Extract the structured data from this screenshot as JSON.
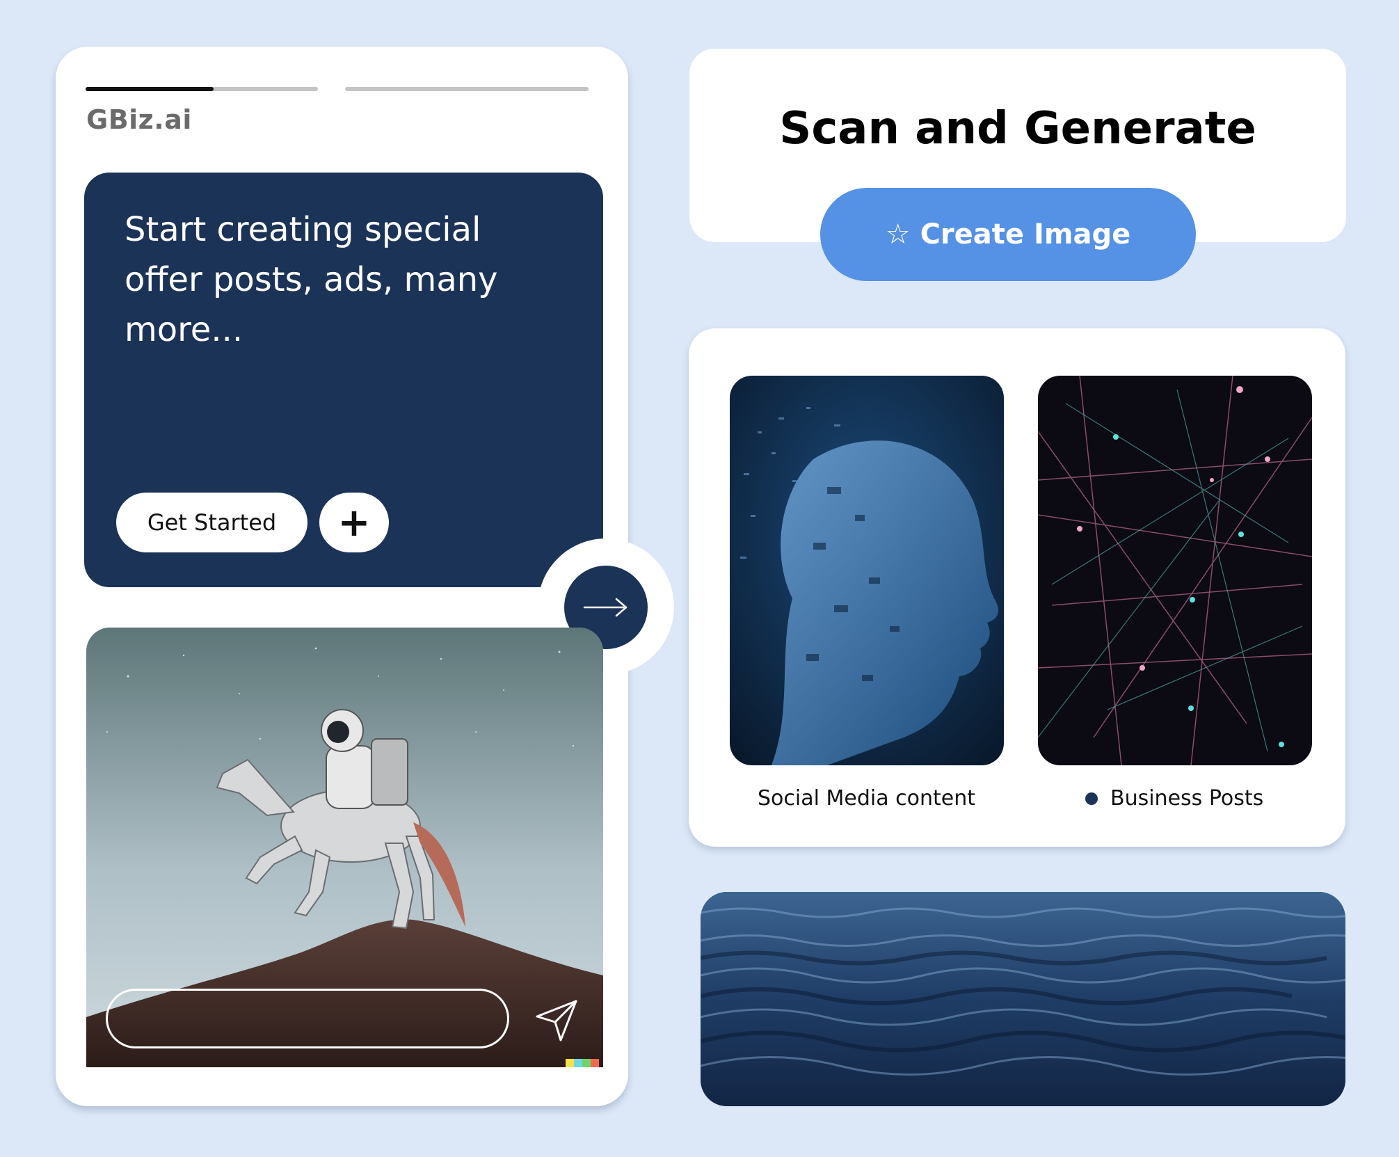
{
  "left_card": {
    "brand": "GBiz.ai",
    "progress": [
      {
        "fraction": 0.55
      },
      {
        "fraction": 0.0
      }
    ],
    "promo": {
      "text": "Start creating special offer posts, ads, many more...",
      "get_started_label": "Get Started",
      "plus_label": "+"
    },
    "prompt_input": {
      "placeholder": "",
      "value": ""
    },
    "icons": {
      "arrow": "arrow-right-icon",
      "send": "send-icon"
    }
  },
  "scan_card": {
    "title": "Scan and  Generate",
    "create_button_label": "Create Image",
    "create_button_icon": "☆"
  },
  "gallery": {
    "items": [
      {
        "label": "Social Media content"
      },
      {
        "label": "Business Posts"
      }
    ]
  },
  "colors": {
    "background": "#dce8f8",
    "navy": "#1c3358",
    "accent_blue": "#5591e5"
  }
}
